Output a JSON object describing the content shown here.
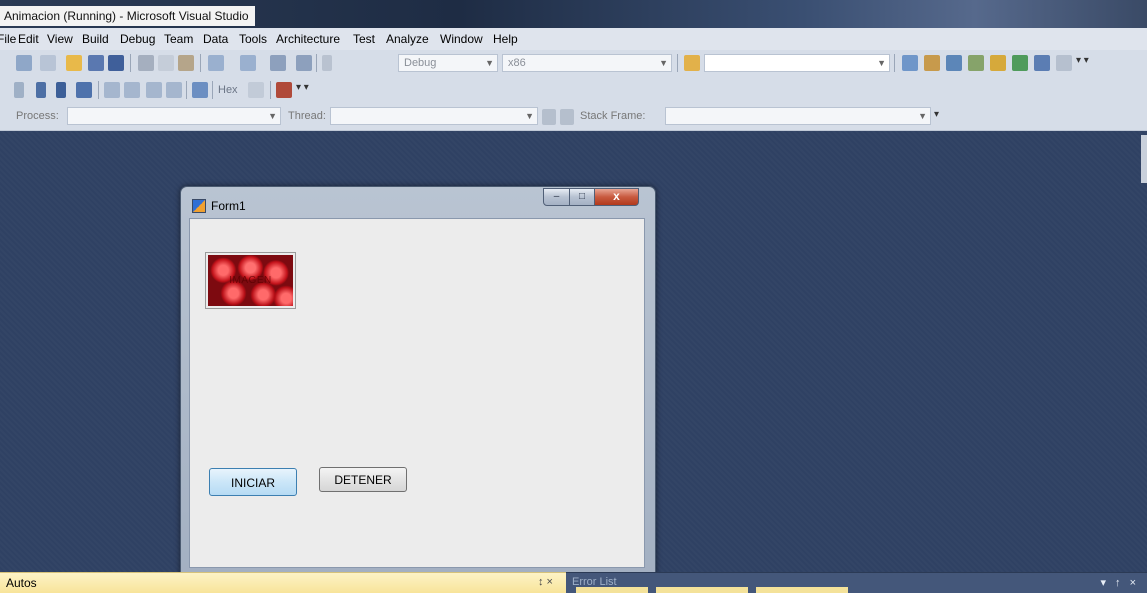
{
  "window": {
    "title": "Animacion (Running) - Microsoft Visual Studio"
  },
  "menu": {
    "items": [
      "File",
      "Edit",
      "View",
      "Build",
      "Debug",
      "Team",
      "Data",
      "Tools",
      "Architecture",
      "Test",
      "Analyze",
      "Window",
      "Help"
    ]
  },
  "toolbar": {
    "config_value": "Debug",
    "platform_value": "x86",
    "hex_label": "Hex",
    "process_label": "Process:",
    "thread_label": "Thread:",
    "stack_frame_label": "Stack Frame:"
  },
  "form1": {
    "title": "Form1",
    "picture_text": "IMAGEN",
    "start_button": "INICIAR",
    "stop_button": "DETENER",
    "window_controls": {
      "minimize": "–",
      "maximize": "□",
      "close": "x"
    }
  },
  "panels": {
    "autos_label": "Autos",
    "error_list_label": "Error List",
    "pin_glyph": "↕ ×",
    "panel_controls": "▾ ↑ ×"
  },
  "colors": {
    "workspace": "#2f4163",
    "autos_panel": "#f8e49a",
    "start_button_border": "#3c7fb1"
  }
}
